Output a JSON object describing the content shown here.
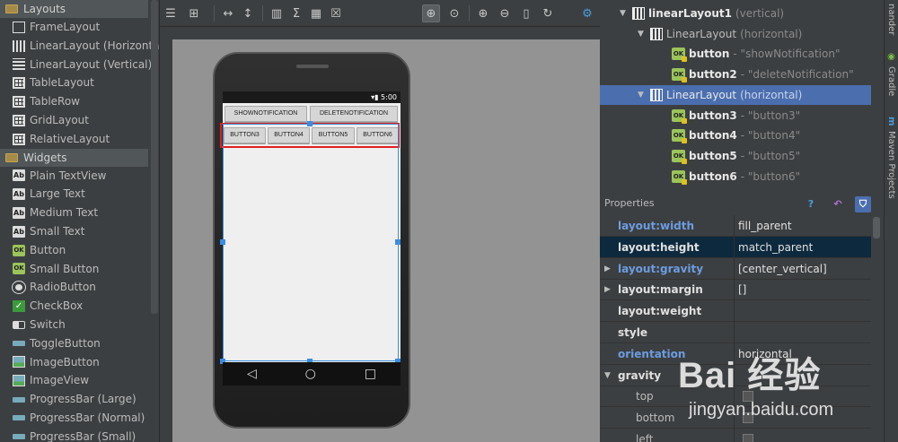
{
  "palette": {
    "groups": [
      {
        "label": "Layouts",
        "items": [
          {
            "label": "FrameLayout",
            "icon": "frame"
          },
          {
            "label": "LinearLayout (Horizontal)",
            "icon": "linh"
          },
          {
            "label": "LinearLayout (Vertical)",
            "icon": "linv"
          },
          {
            "label": "TableLayout",
            "icon": "table"
          },
          {
            "label": "TableRow",
            "icon": "table"
          },
          {
            "label": "GridLayout",
            "icon": "table"
          },
          {
            "label": "RelativeLayout",
            "icon": "table"
          }
        ]
      },
      {
        "label": "Widgets",
        "items": [
          {
            "label": "Plain TextView",
            "icon": "ab"
          },
          {
            "label": "Large Text",
            "icon": "ab"
          },
          {
            "label": "Medium Text",
            "icon": "ab"
          },
          {
            "label": "Small Text",
            "icon": "ab"
          },
          {
            "label": "Button",
            "icon": "ok"
          },
          {
            "label": "Small Button",
            "icon": "ok"
          },
          {
            "label": "RadioButton",
            "icon": "radio"
          },
          {
            "label": "CheckBox",
            "icon": "check"
          },
          {
            "label": "Switch",
            "icon": "switch"
          },
          {
            "label": "ToggleButton",
            "icon": "prog"
          },
          {
            "label": "ImageButton",
            "icon": "img"
          },
          {
            "label": "ImageView",
            "icon": "img"
          },
          {
            "label": "ProgressBar (Large)",
            "icon": "prog"
          },
          {
            "label": "ProgressBar (Normal)",
            "icon": "prog"
          },
          {
            "label": "ProgressBar (Small)",
            "icon": "prog"
          }
        ]
      }
    ]
  },
  "device": {
    "time": "5:00",
    "row1": [
      "SHOWNOTIFICATION",
      "DELETENOTIFICATION"
    ],
    "row2": [
      "BUTTON3",
      "BUTTON4",
      "BUTTON5",
      "BUTTON6"
    ],
    "nav": [
      "◁",
      "○",
      "□"
    ]
  },
  "tree": {
    "rows": [
      {
        "name": "linearLayout1",
        "desc": "(vertical)",
        "type": "layout",
        "level": 0,
        "expanded": true,
        "selected": false
      },
      {
        "name": "LinearLayout",
        "desc": "(horizontal)",
        "type": "layout",
        "level": 1,
        "expanded": true,
        "selected": false
      },
      {
        "name": "button",
        "desc": "- \"showNotification\"",
        "type": "button",
        "level": 2,
        "expanded": false,
        "selected": false
      },
      {
        "name": "button2",
        "desc": "- \"deleteNotification\"",
        "type": "button",
        "level": 2,
        "expanded": false,
        "selected": false
      },
      {
        "name": "LinearLayout",
        "desc": "(horizontal)",
        "type": "layout",
        "level": 1,
        "expanded": true,
        "selected": true
      },
      {
        "name": "button3",
        "desc": "- \"button3\"",
        "type": "button",
        "level": 2,
        "expanded": false,
        "selected": false
      },
      {
        "name": "button4",
        "desc": "- \"button4\"",
        "type": "button",
        "level": 2,
        "expanded": false,
        "selected": false
      },
      {
        "name": "button5",
        "desc": "- \"button5\"",
        "type": "button",
        "level": 2,
        "expanded": false,
        "selected": false
      },
      {
        "name": "button6",
        "desc": "- \"button6\"",
        "type": "button",
        "level": 2,
        "expanded": false,
        "selected": false
      }
    ]
  },
  "side": {
    "top_label": "nander",
    "gradle": "Gradle",
    "maven": "Maven Projects"
  },
  "properties": {
    "title": "Properties",
    "rows": [
      {
        "name": "layout:width",
        "value": "fill_parent",
        "style": "blue",
        "expander": false,
        "selected": false,
        "checkbox": false
      },
      {
        "name": "layout:height",
        "value": "match_parent",
        "style": "white",
        "expander": false,
        "selected": true,
        "checkbox": false
      },
      {
        "name": "layout:gravity",
        "value": "[center_vertical]",
        "style": "blue",
        "expander": true,
        "selected": false,
        "checkbox": false
      },
      {
        "name": "layout:margin",
        "value": "[]",
        "style": "white",
        "expander": true,
        "selected": false,
        "checkbox": false
      },
      {
        "name": "layout:weight",
        "value": "",
        "style": "white",
        "expander": false,
        "selected": false,
        "checkbox": false
      },
      {
        "name": "style",
        "value": "",
        "style": "white",
        "expander": false,
        "selected": false,
        "checkbox": false
      },
      {
        "name": "orientation",
        "value": "horizontal",
        "style": "blue",
        "expander": false,
        "selected": false,
        "checkbox": false
      },
      {
        "name": "gravity",
        "value": "",
        "style": "white",
        "expander": true,
        "expanded": true,
        "selected": false,
        "checkbox": false
      },
      {
        "name": "top",
        "value": "",
        "style": "sub",
        "expander": false,
        "selected": false,
        "checkbox": true
      },
      {
        "name": "bottom",
        "value": "",
        "style": "sub",
        "expander": false,
        "selected": false,
        "checkbox": true
      },
      {
        "name": "left",
        "value": "",
        "style": "sub",
        "expander": false,
        "selected": false,
        "checkbox": true
      }
    ]
  },
  "watermark": {
    "brand": "Bai 经验",
    "url": "jingyan.baidu.com"
  },
  "colors": {
    "selection": "#4b6eaf",
    "highlight_box": "#e02020",
    "property_blue": "#6c9ce0"
  }
}
